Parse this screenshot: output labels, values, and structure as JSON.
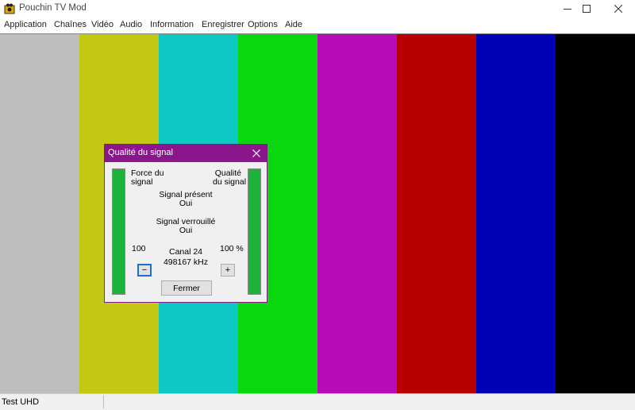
{
  "window": {
    "title": "Pouchin TV Mod",
    "controls": {
      "minimize": "—",
      "maximize": "☐",
      "close": "✕"
    }
  },
  "menu": [
    "Application",
    "Chaînes",
    "Vidéo",
    "Audio",
    "Information",
    "Enregistrer",
    "Options",
    "Aide"
  ],
  "color_bars": [
    "#bebebe",
    "#c3c913",
    "#0bc8c2",
    "#0ad80f",
    "#b80cbb",
    "#b90000",
    "#0000b9",
    "#000000"
  ],
  "dialog": {
    "title": "Qualité du signal",
    "left_label": [
      "Force du",
      "signal"
    ],
    "right_label": [
      "Qualité",
      "du signal"
    ],
    "signal_present_label": "Signal présent",
    "signal_present_value": "Oui",
    "signal_locked_label": "Signal verrouillé",
    "signal_locked_value": "Oui",
    "strength_value": "100",
    "quality_value": "100 %",
    "channel": "Canal 24",
    "frequency": "498167 kHz",
    "minus": "−",
    "plus": "+",
    "close_button": "Fermer",
    "meter_color": "#1db33b",
    "title_color": "#8b168b",
    "strength_level": 1.0,
    "quality_level": 1.0
  },
  "status": {
    "text": "Test UHD"
  }
}
